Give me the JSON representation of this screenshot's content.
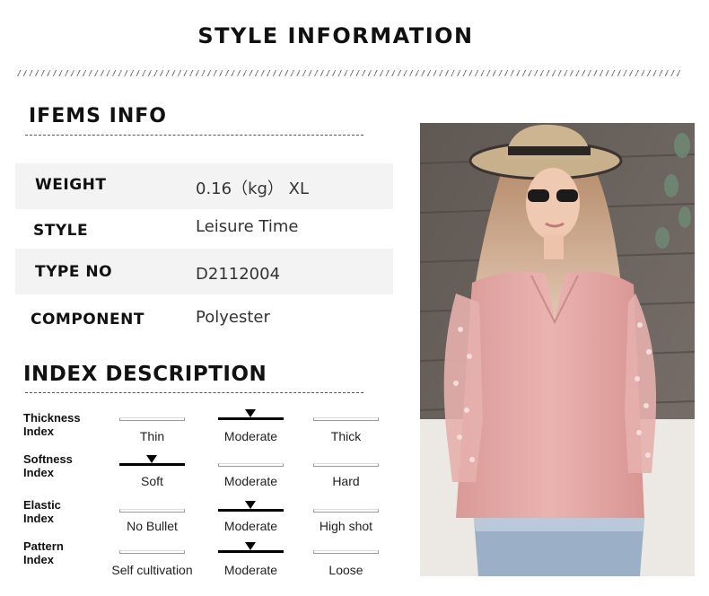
{
  "title": "STYLE INFORMATION",
  "items_section": {
    "heading": "IFEMS INFO",
    "rows": [
      {
        "key": "WEIGHT",
        "value": "0.16（kg） XL"
      },
      {
        "key": "STYLE",
        "value": "Leisure Time"
      },
      {
        "key": "TYPE NO",
        "value": "D2112004"
      },
      {
        "key": "COMPONENT",
        "value": "Polyester"
      }
    ]
  },
  "index_section": {
    "heading": "INDEX DESCRIPTION",
    "indexes": [
      {
        "label_line1": "Thickness",
        "label_line2": "Index",
        "options": [
          "Thin",
          "Moderate",
          "Thick"
        ],
        "selected": "Moderate"
      },
      {
        "label_line1": "Softness",
        "label_line2": "Index",
        "options": [
          "Soft",
          "Moderate",
          "Hard"
        ],
        "selected": "Soft"
      },
      {
        "label_line1": "Elastic",
        "label_line2": "Index",
        "options": [
          "No Bullet",
          "Moderate",
          "High shot"
        ],
        "selected": "Moderate"
      },
      {
        "label_line1": "Pattern",
        "label_line2": "Index",
        "options": [
          "Self cultivation",
          "Moderate",
          "Loose"
        ],
        "selected": "Moderate"
      }
    ]
  },
  "colors": {
    "blouse": "#e3a9a6",
    "wall": "#6f6761",
    "background": "#ffffff"
  }
}
